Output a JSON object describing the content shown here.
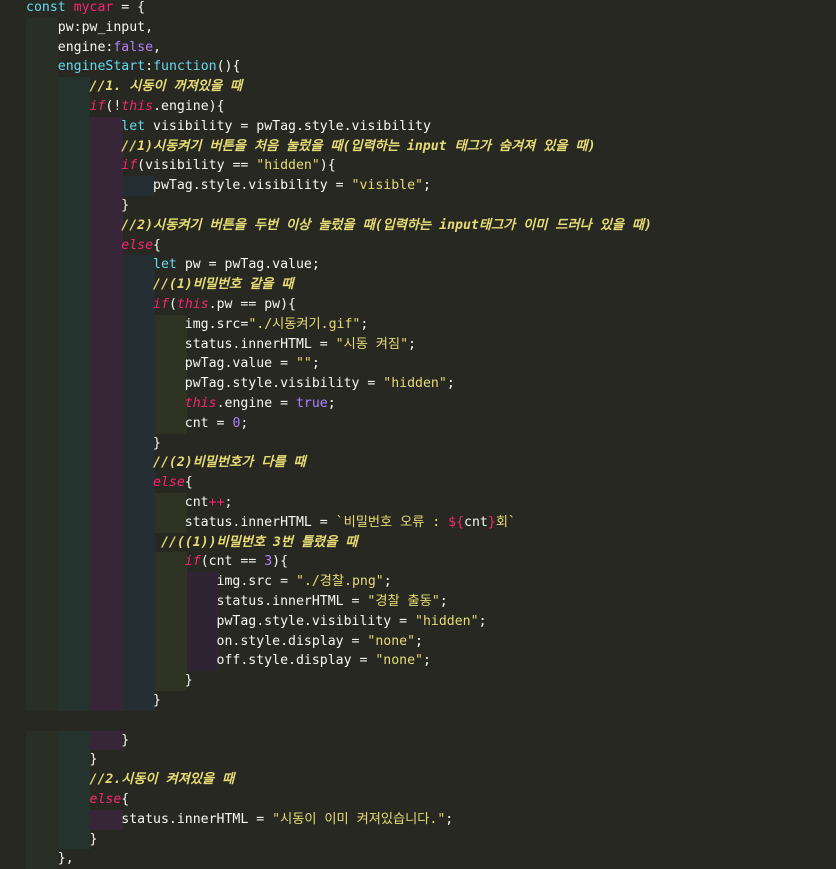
{
  "editor": {
    "language": "javascript",
    "theme_colors": {
      "background": "#272822",
      "keyword": "#66d9ef",
      "storage": "#f92672",
      "string": "#e6db74",
      "number": "#ae81ff",
      "comment": "#e6db74",
      "property": "#a6e22e",
      "text": "#f8f8f2"
    },
    "lines": [
      [
        {
          "t": "const",
          "c": "kw"
        },
        {
          "t": " "
        },
        {
          "t": "mycar",
          "c": "var"
        },
        {
          "t": " = {"
        }
      ],
      [
        {
          "t": "    pw:pw_input,"
        }
      ],
      [
        {
          "t": "    engine:"
        },
        {
          "t": "false",
          "c": "lit"
        },
        {
          "t": ","
        }
      ],
      [
        {
          "t": "    "
        },
        {
          "t": "engineStart",
          "c": "fn"
        },
        {
          "t": ":"
        },
        {
          "t": "function",
          "c": "kw"
        },
        {
          "t": "(){"
        }
      ],
      [
        {
          "t": "        "
        },
        {
          "t": "//1. 시동이 꺼져있을 때",
          "c": "cm"
        }
      ],
      [
        {
          "t": "        "
        },
        {
          "t": "if",
          "c": "ctl"
        },
        {
          "t": "(!"
        },
        {
          "t": "this",
          "c": "this"
        },
        {
          "t": ".engine){"
        }
      ],
      [
        {
          "t": "            "
        },
        {
          "t": "let",
          "c": "kw"
        },
        {
          "t": " visibility = pwTag.style.visibility"
        }
      ],
      [
        {
          "t": "            "
        },
        {
          "t": "//1)시동켜기 버튼을 처음 눌렀을 때(입력하는 input 태그가 숨겨져 있을 때)",
          "c": "cm"
        }
      ],
      [
        {
          "t": "            "
        },
        {
          "t": "if",
          "c": "ctl"
        },
        {
          "t": "(visibility == "
        },
        {
          "t": "\"hidden\"",
          "c": "str"
        },
        {
          "t": "){"
        }
      ],
      [
        {
          "t": "                pwTag.style.visibility = "
        },
        {
          "t": "\"visible\"",
          "c": "str"
        },
        {
          "t": ";"
        }
      ],
      [
        {
          "t": "            }"
        }
      ],
      [
        {
          "t": "            "
        },
        {
          "t": "//2)시동켜기 버튼을 두번 이상 눌렀을 때(입력하는 input태그가 이미 드러나 있을 때)",
          "c": "cm"
        }
      ],
      [
        {
          "t": "            "
        },
        {
          "t": "else",
          "c": "ctl"
        },
        {
          "t": "{"
        }
      ],
      [
        {
          "t": "                "
        },
        {
          "t": "let",
          "c": "kw"
        },
        {
          "t": " pw = pwTag.value;"
        }
      ],
      [
        {
          "t": "                "
        },
        {
          "t": "//(1)비밀번호 같을 때",
          "c": "cm"
        }
      ],
      [
        {
          "t": "                "
        },
        {
          "t": "if",
          "c": "ctl"
        },
        {
          "t": "("
        },
        {
          "t": "this",
          "c": "this"
        },
        {
          "t": ".pw == pw){"
        }
      ],
      [
        {
          "t": "                    img.src="
        },
        {
          "t": "\"./시동켜기.gif\"",
          "c": "str"
        },
        {
          "t": ";"
        }
      ],
      [
        {
          "t": "                    status.innerHTML = "
        },
        {
          "t": "\"시동 켜짐\"",
          "c": "str"
        },
        {
          "t": ";"
        }
      ],
      [
        {
          "t": "                    pwTag.value = "
        },
        {
          "t": "\"\"",
          "c": "str"
        },
        {
          "t": ";"
        }
      ],
      [
        {
          "t": "                    pwTag.style.visibility = "
        },
        {
          "t": "\"hidden\"",
          "c": "str"
        },
        {
          "t": ";"
        }
      ],
      [
        {
          "t": "                    "
        },
        {
          "t": "this",
          "c": "this"
        },
        {
          "t": ".engine = "
        },
        {
          "t": "true",
          "c": "lit"
        },
        {
          "t": ";"
        }
      ],
      [
        {
          "t": "                    cnt = "
        },
        {
          "t": "0",
          "c": "num"
        },
        {
          "t": ";"
        }
      ],
      [
        {
          "t": "                }"
        }
      ],
      [
        {
          "t": "                "
        },
        {
          "t": "//(2)비밀번호가 다를 때",
          "c": "cm"
        }
      ],
      [
        {
          "t": "                "
        },
        {
          "t": "else",
          "c": "ctl"
        },
        {
          "t": "{"
        }
      ],
      [
        {
          "t": "                    cnt"
        },
        {
          "t": "++",
          "c": "op"
        },
        {
          "t": ";"
        }
      ],
      [
        {
          "t": "                    status.innerHTML = "
        },
        {
          "t": "`비밀번호 오류 : ",
          "c": "str"
        },
        {
          "t": "${",
          "c": "op"
        },
        {
          "t": "cnt"
        },
        {
          "t": "}",
          "c": "op"
        },
        {
          "t": "회`",
          "c": "str"
        }
      ],
      [
        {
          "t": "                 "
        },
        {
          "t": "//((1))비밀번호 3번 틀렸을 때",
          "c": "cm"
        }
      ],
      [
        {
          "t": "                    "
        },
        {
          "t": "if",
          "c": "ctl"
        },
        {
          "t": "(cnt == "
        },
        {
          "t": "3",
          "c": "num"
        },
        {
          "t": "){"
        }
      ],
      [
        {
          "t": "                        img.src = "
        },
        {
          "t": "\"./경찰.png\"",
          "c": "str"
        },
        {
          "t": ";"
        }
      ],
      [
        {
          "t": "                        status.innerHTML = "
        },
        {
          "t": "\"경찰 출동\"",
          "c": "str"
        },
        {
          "t": ";"
        }
      ],
      [
        {
          "t": "                        pwTag.style.visibility = "
        },
        {
          "t": "\"hidden\"",
          "c": "str"
        },
        {
          "t": ";"
        }
      ],
      [
        {
          "t": "                        on.style.display = "
        },
        {
          "t": "\"none\"",
          "c": "str"
        },
        {
          "t": ";"
        }
      ],
      [
        {
          "t": "                        off.style.display = "
        },
        {
          "t": "\"none\"",
          "c": "str"
        },
        {
          "t": ";"
        }
      ],
      [
        {
          "t": "                    }"
        }
      ],
      [
        {
          "t": "                }"
        }
      ],
      [
        {
          "t": ""
        }
      ],
      [
        {
          "t": "            }"
        }
      ],
      [
        {
          "t": "        }"
        }
      ],
      [
        {
          "t": "        "
        },
        {
          "t": "//2.시동이 켜져있을 때",
          "c": "cm"
        }
      ],
      [
        {
          "t": "        "
        },
        {
          "t": "else",
          "c": "ctl"
        },
        {
          "t": "{"
        }
      ],
      [
        {
          "t": "            status.innerHTML = "
        },
        {
          "t": "\"시동이 이미 켜져있습니다.\"",
          "c": "str"
        },
        {
          "t": ";"
        }
      ],
      [
        {
          "t": "        }"
        }
      ],
      [
        {
          "t": "    },"
        }
      ]
    ]
  }
}
